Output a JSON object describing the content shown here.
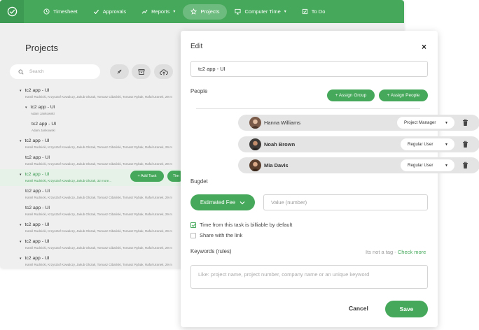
{
  "nav": {
    "items": [
      {
        "label": "Timesheet",
        "icon": "clock-icon"
      },
      {
        "label": "Approvals",
        "icon": "check-icon"
      },
      {
        "label": "Reports",
        "icon": "trend-icon",
        "caret": "▾"
      },
      {
        "label": "Projects",
        "icon": "star-icon",
        "active": true
      },
      {
        "label": "Computer Time",
        "icon": "monitor-icon",
        "caret": "▾"
      },
      {
        "label": "To Do",
        "icon": "checkbox-icon"
      }
    ]
  },
  "projects": {
    "title": "Projects",
    "search_placeholder": "Search",
    "rows": [
      {
        "title": "tc2 app - UI",
        "caret": "▾",
        "sub": "Kamil Rudnicki, Krzysztof Kowalczy, Jakub Olszak, Tomasz Cibański, Tomasz Rybak, Rafał Uranek, 29 m"
      },
      {
        "title": "tc2 app - UI",
        "caret": "▾",
        "sub": "Adam Jankowski"
      },
      {
        "title": "tc2 app - UI",
        "caret": "",
        "sub": "Adam Jankowski"
      },
      {
        "title": "tc2 app - UI",
        "caret": "▾",
        "sub": "Kamil Rudnicki, Krzysztof Kowalczy, Jakub Olszak, Tomasz Cibański, Tomasz Rybak, Rafał Uranek, 29 m"
      },
      {
        "title": "tc2 app - UI",
        "caret": "",
        "sub": "Kamil Rudnicki, Krzysztof Kowalczy, Jakub Olszak, Tomasz Cibański, Tomasz Rybak, Rafał Uranek, 29 m"
      },
      {
        "title": "tc2 app - UI",
        "caret": "▾",
        "sub": "Kamil Rudnicki, Krzysztof Kowalczy, Jakub Olszak, 32 more..."
      },
      {
        "title": "tc2 app - UI",
        "caret": "",
        "sub": "Kamil Rudnicki, Krzysztof Kowalczy, Jakub Olszak, Tomasz Cibański, Tomasz Rybak, Rafał Uranek, 29 m"
      },
      {
        "title": "tc2 app - UI",
        "caret": "",
        "sub": "Kamil Rudnicki, Krzysztof Kowalczy, Jakub Olszak, Tomasz Cibański, Tomasz Rybak, Rafał Uranek, 29 m"
      },
      {
        "title": "tc2 app - UI",
        "caret": "▾",
        "sub": "Kamil Rudnicki, Krzysztof Kowalczy, Jakub Olszak, Tomasz Cibański, Tomasz Rybak, Rafał Uranek, 29 m"
      },
      {
        "title": "tc2 app - UI",
        "caret": "▾",
        "sub": "Kamil Rudnicki, Krzysztof Kowalczy, Jakub Olszak, Tomasz Cibański, Tomasz Rybak, Rafał Uranek, 29 m"
      },
      {
        "title": "tc2 app - UI",
        "caret": "▾",
        "sub": "Kamil Rudnicki, Krzysztof Kowalczy, Jakub Olszak, Tomasz Cibański, Tomasz Rybak, Rafał Uranek, 29 m"
      }
    ],
    "add_task_label": "+ Add Task",
    "time_label": "Tim"
  },
  "dialog": {
    "title": "Edit",
    "close": "×",
    "name_value": "tc2 app - UI",
    "people_label": "People",
    "assign_group": "+ Assign Group",
    "assign_people": "+ Assign People",
    "people": [
      {
        "name": "Hanna Williams",
        "role": "Project Manager"
      },
      {
        "name": "Noah Brown",
        "role": "Regular User"
      },
      {
        "name": "Mia Davis",
        "role": "Regular User"
      }
    ],
    "budget_label": "Bugdet",
    "fee_button": "Estimated Fee",
    "value_placeholder": "Value (number)",
    "billable_label": "Time from this task is billiable by default",
    "share_label": "Share with the link",
    "keywords_label": "Keywords (rules)",
    "keywords_note": "Its not a tag - ",
    "check_more": "Check more",
    "keywords_placeholder": "Like: project name, project number, company name or an unique keyword",
    "cancel": "Cancel",
    "save": "Save"
  },
  "colors": {
    "accent": "#45a85a",
    "selected_row": "#e6f2e8"
  }
}
